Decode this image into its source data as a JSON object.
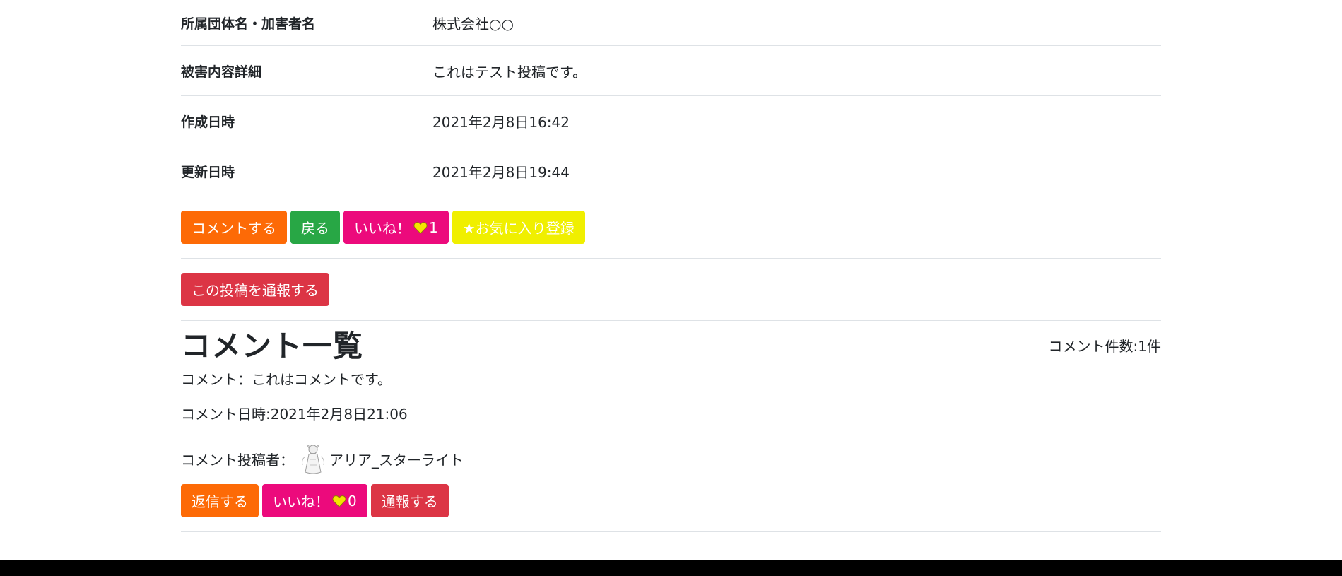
{
  "details": [
    {
      "label": "所属団体名・加害者名",
      "value": "株式会社○○"
    },
    {
      "label": "被害内容詳細",
      "value": "これはテスト投稿です。"
    },
    {
      "label": "作成日時",
      "value": "2021年2月8日16:42"
    },
    {
      "label": "更新日時",
      "value": "2021年2月8日19:44"
    }
  ],
  "post_actions": {
    "comment_label": "コメントする",
    "back_label": "戻る",
    "like_label": "いいね！",
    "like_count": "1",
    "favorite_label": "★お気に入り登録"
  },
  "report_post_label": "この投稿を通報する",
  "comments": {
    "title": "コメント一覧",
    "count_text": "コメント件数:1件",
    "items": [
      {
        "text": "コメント：これはコメントです。",
        "date": "コメント日時:2021年2月8日21:06",
        "poster_label": "コメント投稿者：",
        "poster_name": "アリア_スターライト",
        "reply_label": "返信する",
        "like_label": "いいね！",
        "like_count": "0",
        "report_label": "通報する"
      }
    ]
  },
  "colors": {
    "orange": "#fd6a06",
    "green": "#28a745",
    "pink": "#ec0a7c",
    "yellow": "#f0ef00",
    "red": "#dc3545",
    "heart": "#f5e400"
  },
  "icons": {
    "heart": "heart-icon",
    "avatar": "avatar"
  }
}
